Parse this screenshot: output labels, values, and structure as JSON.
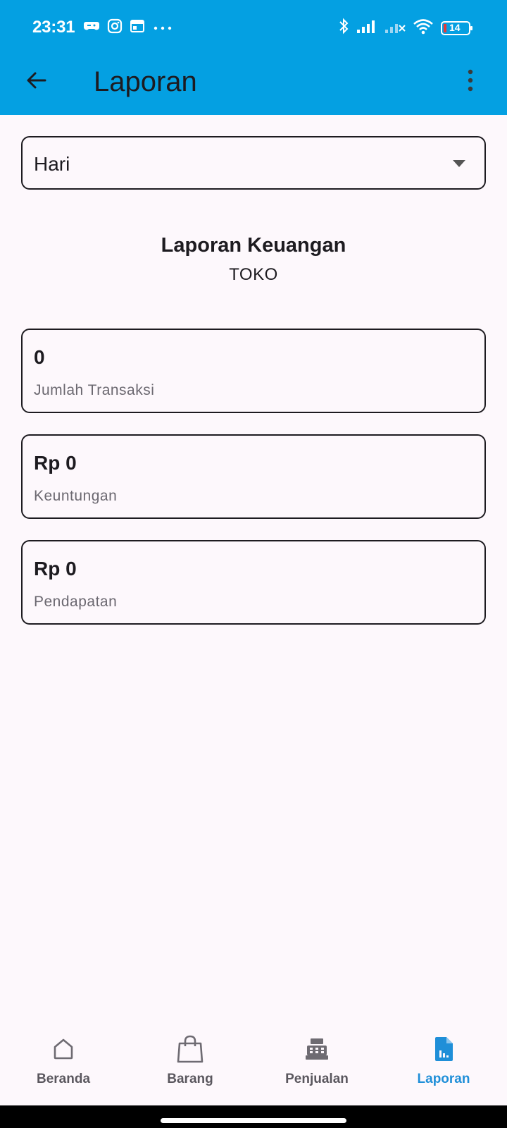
{
  "status_bar": {
    "time": "23:31",
    "battery": "14",
    "left_icons": [
      "game-icon",
      "instagram-icon",
      "calendar-icon",
      "more-dots-icon"
    ],
    "right_icons": [
      "bluetooth-icon",
      "signal-icon",
      "signal-no-service-icon",
      "wifi-icon",
      "battery-icon"
    ]
  },
  "app_bar": {
    "title": "Laporan",
    "back_icon": "arrow-back-icon",
    "menu_icon": "more-vert-icon"
  },
  "period_select": {
    "selected": "Hari"
  },
  "report": {
    "title": "Laporan Keuangan",
    "subtitle": "TOKO"
  },
  "cards": [
    {
      "value": "0",
      "label": "Jumlah Transaksi"
    },
    {
      "value": "Rp 0",
      "label": "Keuntungan"
    },
    {
      "value": "Rp 0",
      "label": "Pendapatan"
    }
  ],
  "bottom_nav": {
    "items": [
      {
        "label": "Beranda",
        "icon": "home-icon",
        "active": false
      },
      {
        "label": "Barang",
        "icon": "shopping-bag-icon",
        "active": false
      },
      {
        "label": "Penjualan",
        "icon": "cash-register-icon",
        "active": false
      },
      {
        "label": "Laporan",
        "icon": "report-icon",
        "active": true
      }
    ]
  },
  "colors": {
    "app_bar": "#04a0e2",
    "background": "#fdf8fc",
    "active_nav": "#1f8fd8"
  }
}
